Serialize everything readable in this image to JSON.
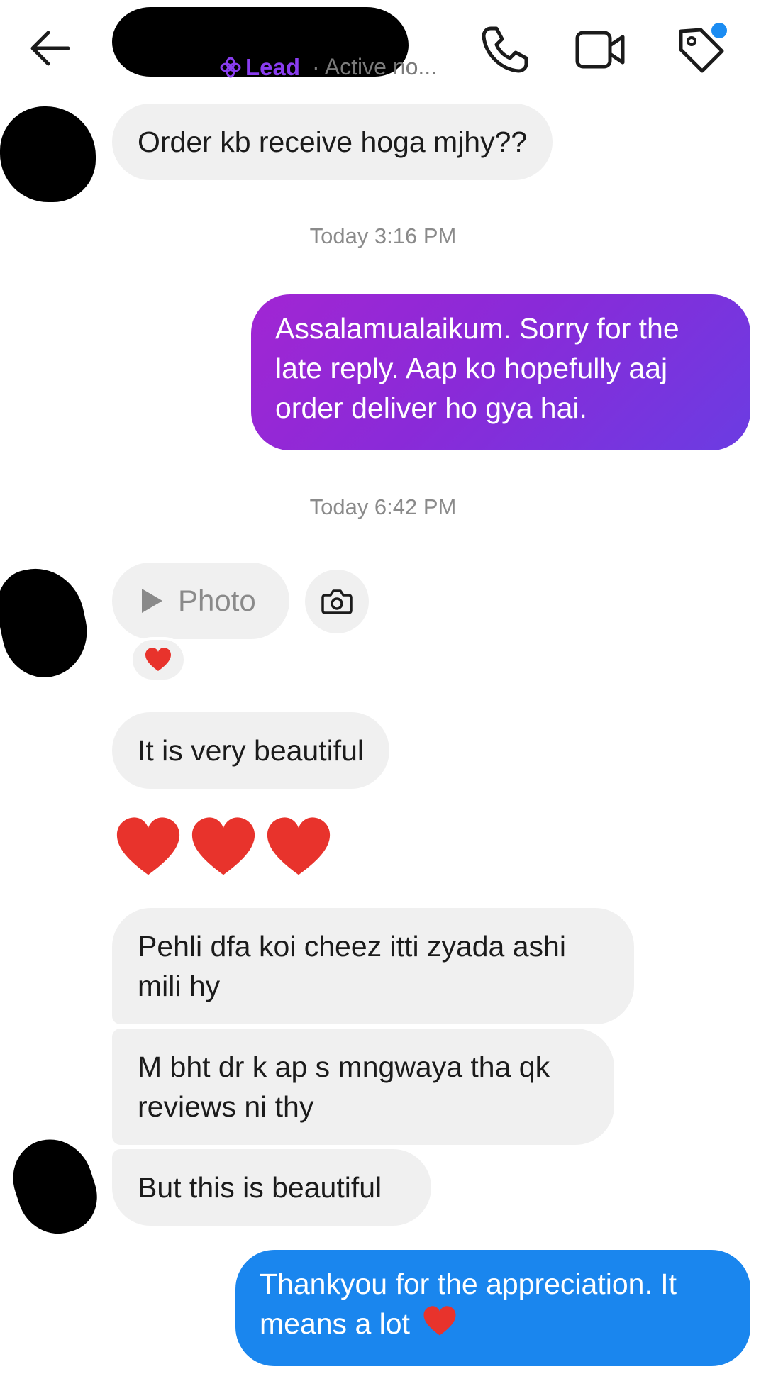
{
  "header": {
    "lead_label": "Lead",
    "active_status": "· Active no..."
  },
  "conversation": {
    "msg_order_question": "Order kb receive hoga mjhy??",
    "timestamp_1": "Today 3:16 PM",
    "msg_reply_sorry": "Assalamualaikum. Sorry for the late reply. Aap ko hopefully aaj order deliver ho gya hai.",
    "timestamp_2": "Today 6:42 PM",
    "photo_label": "Photo",
    "photo_reaction": "❤️",
    "msg_beautiful": "It is very beautiful",
    "msg_hearts": [
      "❤",
      "❤",
      "❤"
    ],
    "msg_first_time": "Pehli dfa koi cheez itti zyada ashi mili hy",
    "msg_reviews": "M bht dr k ap s mngwaya tha qk reviews ni thy",
    "msg_but_beautiful": "But this is beautiful",
    "msg_thanks": "Thankyou for the appreciation. It means a lot",
    "msg_thanks_emoji": "❤"
  },
  "colors": {
    "incoming_bubble": "#f0f0f0",
    "outgoing_purple": "#8a2ad8",
    "outgoing_blue": "#1a86ee",
    "lead_accent": "#8a3df0",
    "online_green": "#31a24c",
    "heart_red": "#e8332c"
  },
  "icons": {
    "back": "arrow-left-icon",
    "call": "phone-icon",
    "video": "video-camera-icon",
    "label": "tag-icon",
    "lead": "lead-flower-icon",
    "photo_play": "play-icon",
    "camera": "camera-icon"
  }
}
